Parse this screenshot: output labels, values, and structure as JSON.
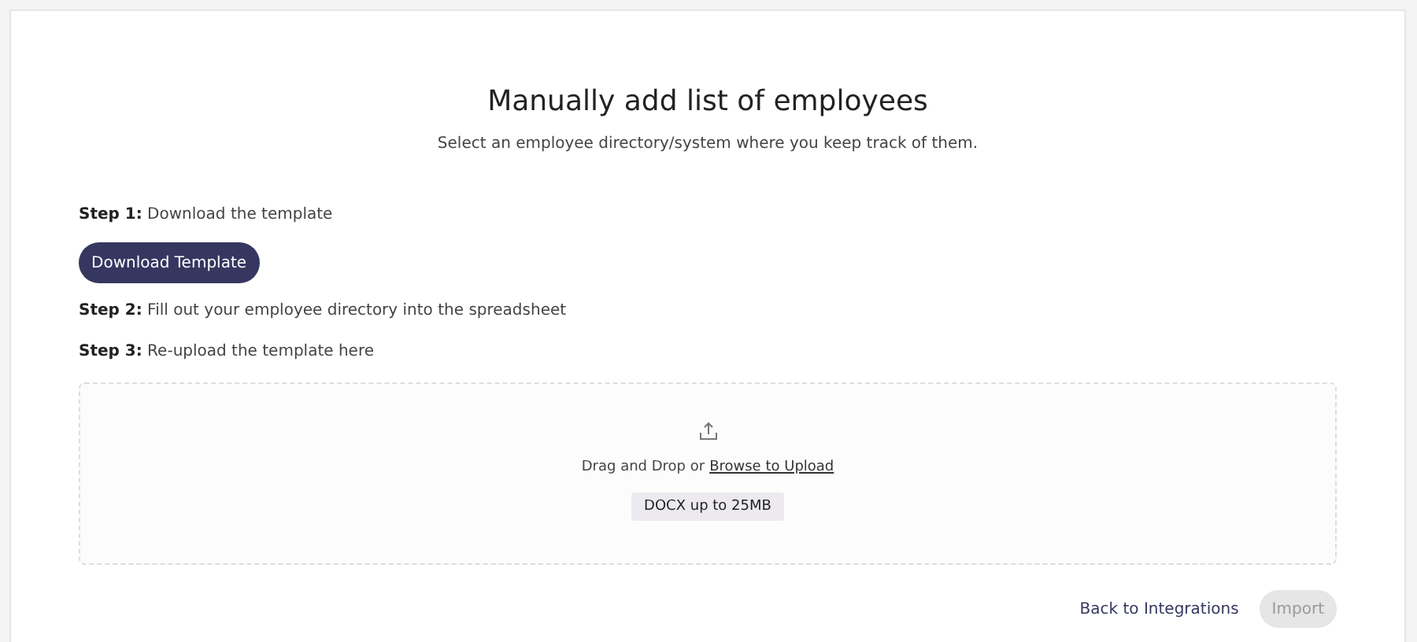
{
  "title": "Manually add list of employees",
  "subtitle": "Select an employee directory/system where you keep track of them.",
  "steps": [
    {
      "text": "**Step 1:** Download the template",
      "button": "Download Template"
    },
    {
      "text": "**Step 2:** Fill out your employee directory into the spreadsheet"
    },
    {
      "text": "**Step 3:** Re-upload the template here"
    }
  ],
  "upload": {
    "prompt": "Drag and Drop or",
    "link": "Browse to Upload",
    "hint": "DOCX up to 25MB"
  },
  "footer": {
    "back": "Back to Integrations",
    "import": {
      "label": "Import",
      "disabled": true
    }
  }
}
